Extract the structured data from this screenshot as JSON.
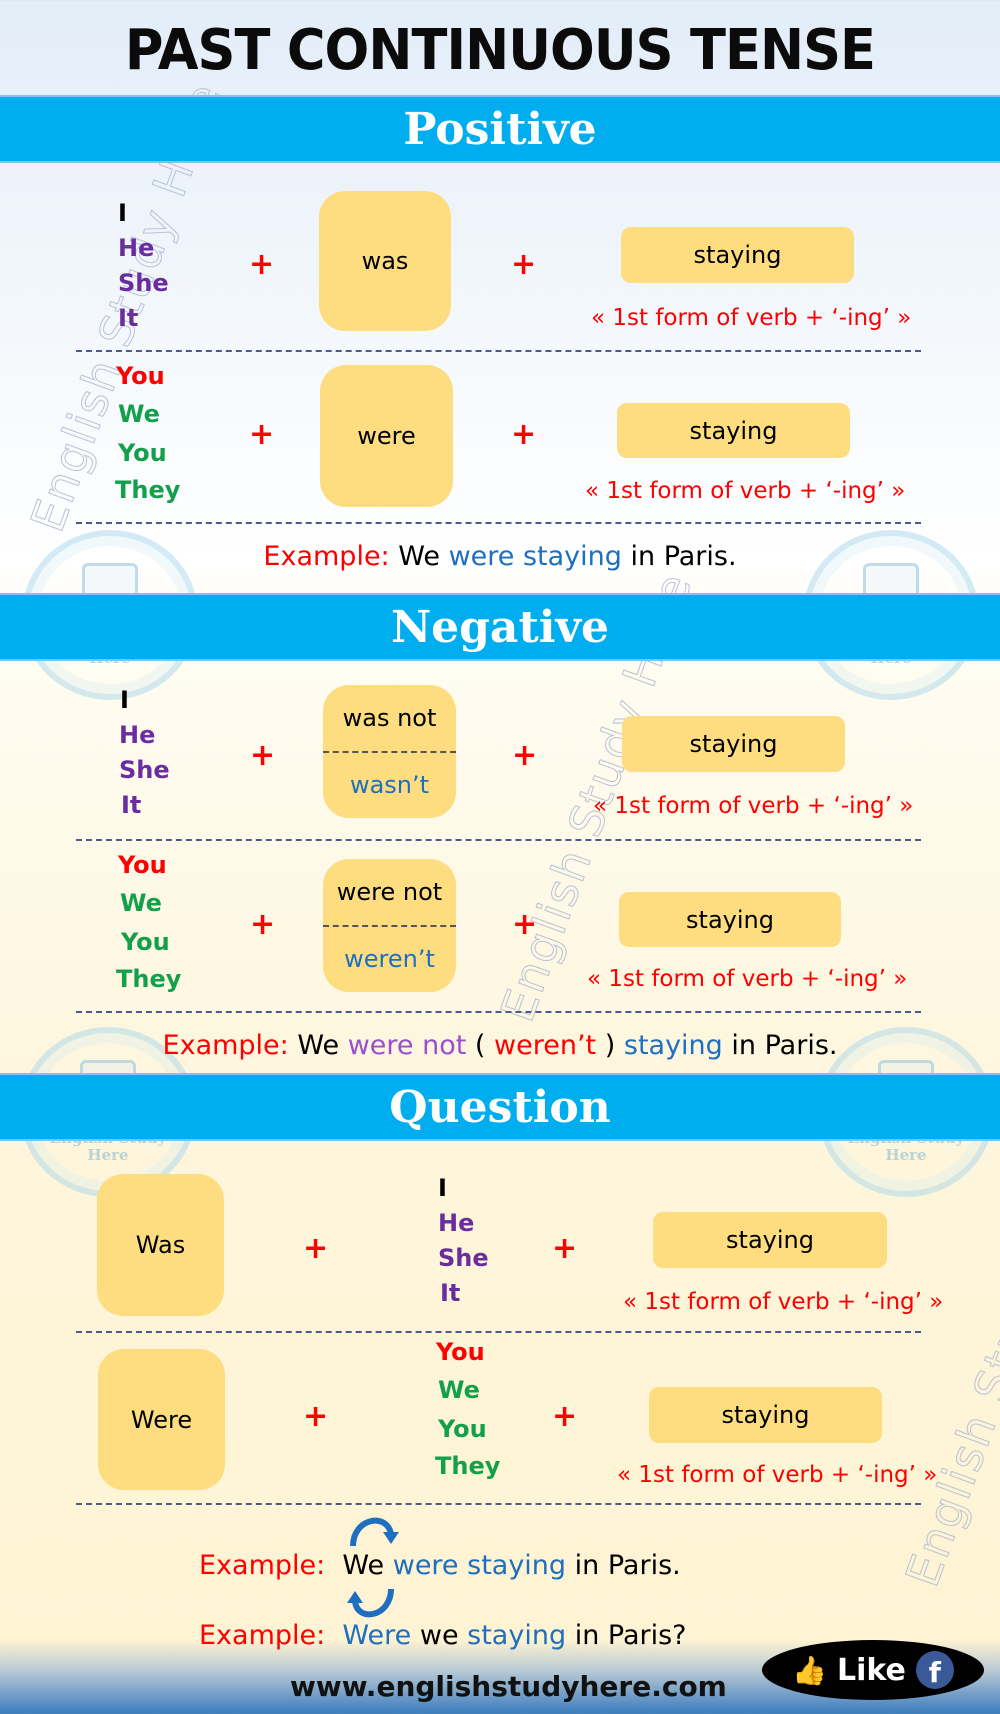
{
  "title": "PAST CONTINUOUS TENSE",
  "watermark": {
    "text": "English Study Here",
    "logo_line1": "English Study",
    "logo_line2": "Here"
  },
  "colors": {
    "band": "#00aeef",
    "box": "#fddd80",
    "red": "#ff0000",
    "purple": "#6a2d9f",
    "green": "#12a14a",
    "blue": "#1f6fc0"
  },
  "positive": {
    "heading": "Positive",
    "rows": [
      {
        "pronouns": [
          "I",
          "He",
          "She",
          "It"
        ],
        "plus": "+",
        "aux": "was",
        "verb": "staying",
        "rule": "« 1st form of verb + ‘-ing’ »"
      },
      {
        "pronouns": [
          "You",
          "We",
          "You",
          "They"
        ],
        "plus": "+",
        "aux": "were",
        "verb": "staying",
        "rule": "« 1st form of verb + ‘-ing’ »"
      }
    ],
    "example": {
      "label": "Example:",
      "subject": "We",
      "verb_phrase": "were staying",
      "rest": "in Paris."
    }
  },
  "negative": {
    "heading": "Negative",
    "rows": [
      {
        "pronouns": [
          "I",
          "He",
          "She",
          "It"
        ],
        "plus": "+",
        "aux_full": "was not",
        "aux_short": "wasn’t",
        "verb": "staying",
        "rule": "« 1st form of verb + ‘-ing’ »"
      },
      {
        "pronouns": [
          "You",
          "We",
          "You",
          "They"
        ],
        "plus": "+",
        "aux_full": "were not",
        "aux_short": "weren’t",
        "verb": "staying",
        "rule": "« 1st form of verb + ‘-ing’ »"
      }
    ],
    "example": {
      "label": "Example:",
      "subject": "We",
      "neg": "were not",
      "open": "(",
      "short": "weren’t",
      "close": ")",
      "verb": "staying",
      "rest": "in Paris."
    }
  },
  "question": {
    "heading": "Question",
    "rows": [
      {
        "aux": "Was",
        "plus1": "+",
        "pronouns": [
          "I",
          "He",
          "She",
          "It"
        ],
        "plus2": "+",
        "verb": "staying",
        "rule": "« 1st form of verb + ‘-ing’ »"
      },
      {
        "aux": "Were",
        "plus1": "+",
        "pronouns": [
          "You",
          "We",
          "You",
          "They"
        ],
        "plus2": "+",
        "verb": "staying",
        "rule": "« 1st form of verb + ‘-ing’ »"
      }
    ],
    "example1": {
      "label": "Example:",
      "subject": "We",
      "verb_phrase": "were staying",
      "rest": "in Paris."
    },
    "example2": {
      "label": "Example:",
      "aux": "Were",
      "subject": "we",
      "verb": "staying",
      "rest": "in Paris?"
    }
  },
  "footer": {
    "website": "www.englishstudyhere.com",
    "like_label": "Like",
    "like_icon": "thumbs-up-icon",
    "fb_icon": "facebook-icon",
    "fb_letter": "f"
  }
}
